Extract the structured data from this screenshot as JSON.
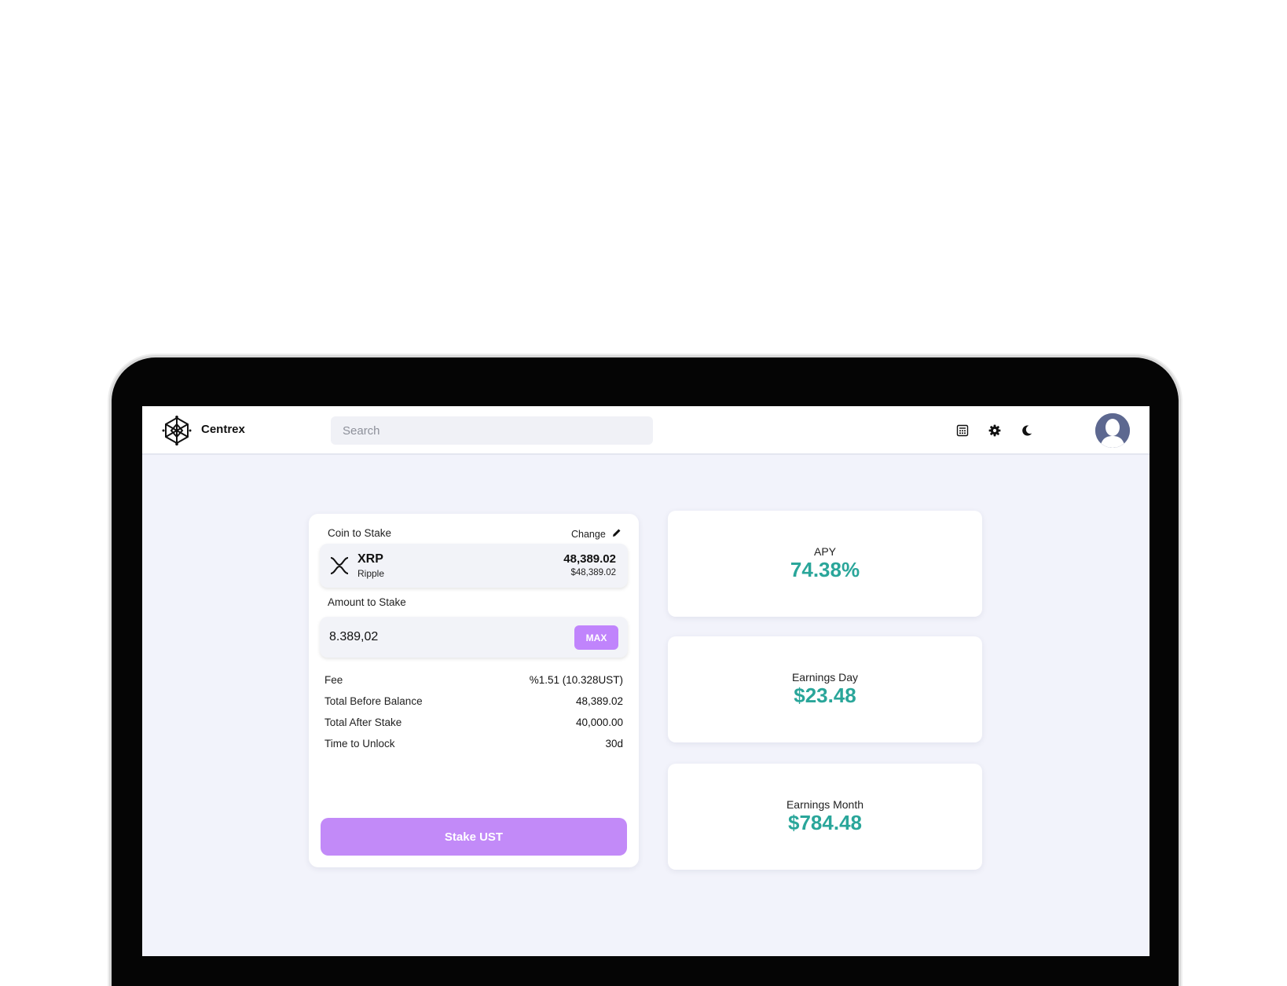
{
  "app": {
    "name": "Centrex",
    "search_placeholder": "Search"
  },
  "header_icons": [
    "calculator-icon",
    "gear-icon",
    "moon-icon",
    "user-avatar"
  ],
  "colors": {
    "accent_purple": "#c084fc",
    "value_teal": "#2aa69a",
    "screen_bg": "#f2f3fb"
  },
  "stake": {
    "coin_label": "Coin to Stake",
    "change_label": "Change",
    "coin": {
      "symbol": "XRP",
      "name": "Ripple",
      "balance": "48,389.02",
      "usd_value": "$48,389.02"
    },
    "amount_label": "Amount to Stake",
    "amount_value": "8.389,02",
    "max_label": "MAX",
    "details": [
      {
        "label": "Fee",
        "value": "%1.51 (10.328UST)"
      },
      {
        "label": "Total Before Balance",
        "value": "48,389.02"
      },
      {
        "label": "Total After Stake",
        "value": "40,000.00"
      },
      {
        "label": "Time to Unlock",
        "value": "30d"
      }
    ],
    "button_label": "Stake UST"
  },
  "stats": [
    {
      "label": "APY",
      "value": "74.38%"
    },
    {
      "label": "Earnings Day",
      "value": "$23.48"
    },
    {
      "label": "Earnings Month",
      "value": "$784.48"
    }
  ]
}
